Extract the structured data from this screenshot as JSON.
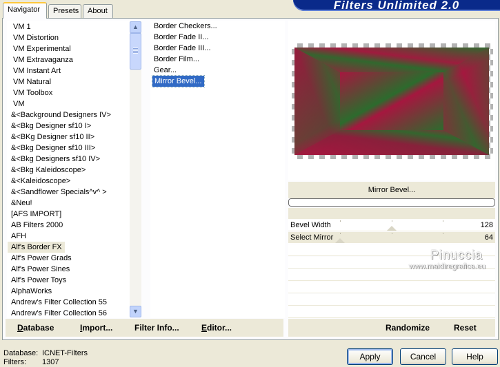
{
  "tabs": [
    {
      "label": "Navigator",
      "active": true
    },
    {
      "label": "Presets",
      "active": false
    },
    {
      "label": "About",
      "active": false
    }
  ],
  "banner_title": "Filters Unlimited 2.0",
  "categories": [
    "VM 1",
    "VM Distortion",
    "VM Experimental",
    "VM Extravaganza",
    "VM Instant Art",
    "VM Natural",
    "VM Toolbox",
    "VM",
    "&<Background Designers IV>",
    "&<Bkg Designer sf10 I>",
    "&<BKg Designer sf10 II>",
    "&<Bkg Designer sf10 III>",
    "&<Bkg Designers sf10 IV>",
    "&<Bkg Kaleidoscope>",
    "&<Kaleidoscope>",
    "&<Sandflower Specials^v^ >",
    "&Neu!",
    "[AFS IMPORT]",
    "AB Filters 2000",
    "AFH",
    "Alf's Border FX",
    "Alf's Power Grads",
    "Alf's Power Sines",
    "Alf's Power Toys",
    "AlphaWorks",
    "Andrew's Filter Collection 55",
    "Andrew's Filter Collection 56"
  ],
  "selected_category": "Alf's Border FX",
  "filters": [
    "Border Checkers...",
    "Border Fade II...",
    "Border Fade III...",
    "Border Film...",
    "Gear...",
    "Mirror Bevel..."
  ],
  "selected_filter": "Mirror Bevel...",
  "filter_name": "Mirror Bevel...",
  "preview_colors": {
    "red": "#a5173f",
    "green": "#2c6b2d"
  },
  "params": [
    {
      "label": "Bevel Width",
      "value": "128",
      "level": 0.5
    },
    {
      "label": "Select Mirror",
      "value": "64",
      "level": 0.0
    }
  ],
  "watermark": {
    "line1": "Pinuccia",
    "line2": "www.maidiregrafica.eu"
  },
  "toolbar_left": [
    "Database",
    "Import...",
    "Filter Info...",
    "Editor..."
  ],
  "toolbar_right": [
    "Randomize",
    "Reset"
  ],
  "status": {
    "db_label": "Database:",
    "db_value": "ICNET-Filters",
    "filters_label": "Filters:",
    "filters_value": "1307"
  },
  "buttons": {
    "apply": "Apply",
    "cancel": "Cancel",
    "help": "Help"
  },
  "icons": {
    "scroll_up": "scroll-up-icon",
    "scroll_down": "scroll-down-icon"
  }
}
